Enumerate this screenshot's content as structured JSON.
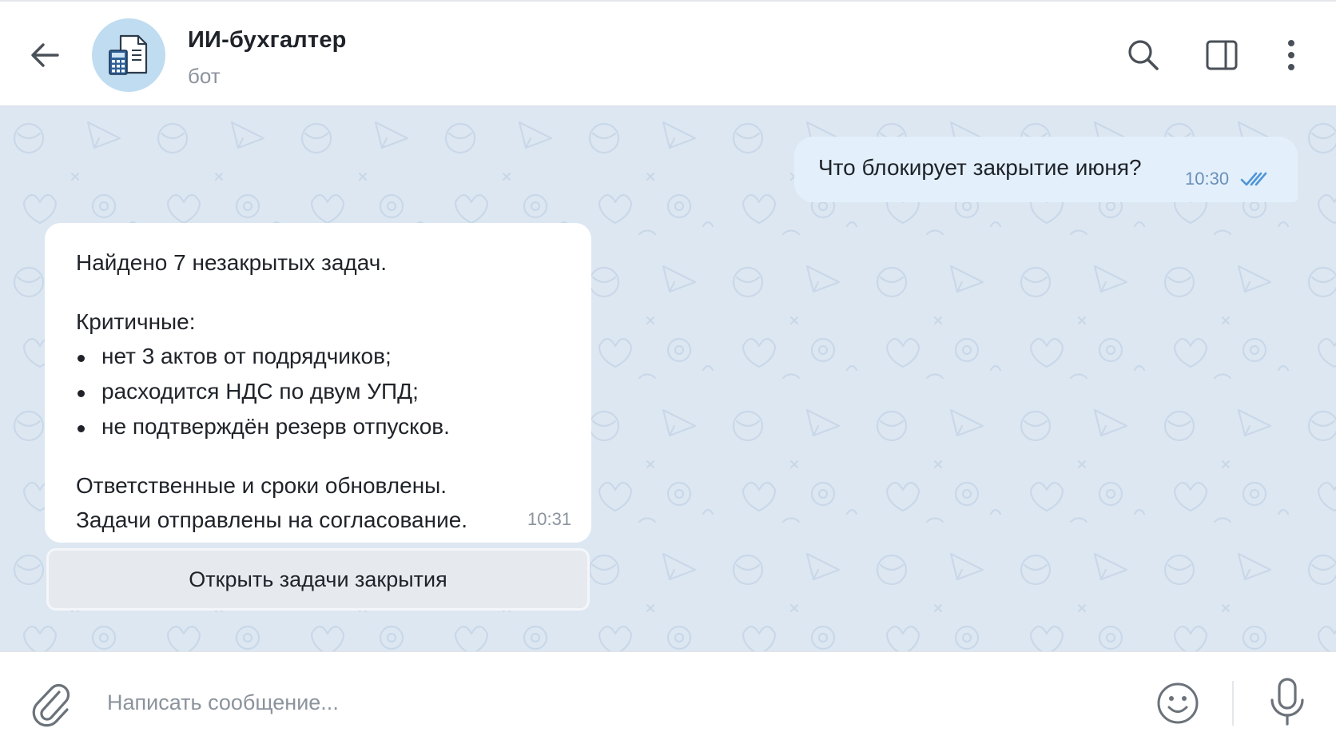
{
  "header": {
    "title": "ИИ-бухгалтер",
    "subtitle": "бот"
  },
  "icons": {
    "back": "arrow-left-icon",
    "avatar": "document-calculator-icon",
    "search": "search-icon",
    "panel": "sidebar-panel-icon",
    "more": "more-vertical-icon",
    "checks": "double-check-icon",
    "attach": "paperclip-icon",
    "emoji": "smiley-icon",
    "mic": "microphone-icon"
  },
  "colors": {
    "avatar_bg": "#bfdcf1",
    "chat_bg": "#dde7f2",
    "outgoing_bubble": "#e3f0fc",
    "incoming_bubble": "#ffffff",
    "read_checks": "#4e95d6"
  },
  "messages": {
    "outgoing": {
      "text": "Что блокирует закрытие июня?",
      "time": "10:30"
    },
    "incoming": {
      "intro": "Найдено 7 незакрытых задач.",
      "critical_header": "Критичные:",
      "bullets": [
        "нет 3 актов от подрядчиков;",
        "расходится НДС по двум УПД;",
        "не подтверждён резерв отпусков."
      ],
      "footer_line1": "Ответственные и сроки обновлены.",
      "footer_line2": "Задачи отправлены на согласование.",
      "time": "10:31",
      "inline_button": "Открыть задачи закрытия"
    }
  },
  "composer": {
    "placeholder": "Написать сообщение...",
    "value": ""
  }
}
